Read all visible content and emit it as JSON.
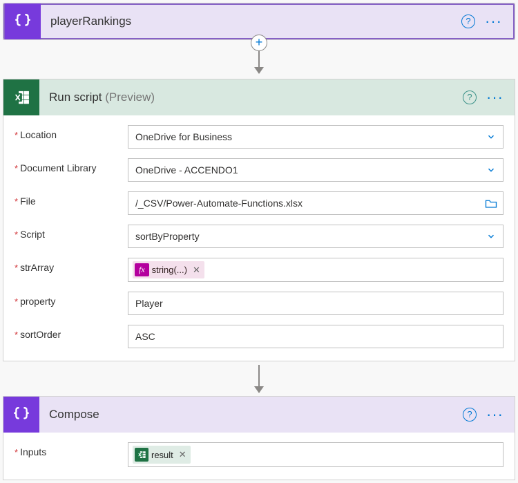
{
  "step1": {
    "title": "playerRankings"
  },
  "step2": {
    "title": "Run script",
    "previewSuffix": "(Preview)",
    "fields": {
      "location": {
        "label": "Location",
        "value": "OneDrive for Business"
      },
      "documentLibrary": {
        "label": "Document Library",
        "value": "OneDrive - ACCENDO1"
      },
      "file": {
        "label": "File",
        "value": "/_CSV/Power-Automate-Functions.xlsx"
      },
      "script": {
        "label": "Script",
        "value": "sortByProperty"
      },
      "strArray": {
        "label": "strArray",
        "chipBadge": "fx",
        "chipText": "string(...)"
      },
      "property": {
        "label": "property",
        "value": "Player"
      },
      "sortOrder": {
        "label": "sortOrder",
        "value": "ASC"
      }
    }
  },
  "step3": {
    "title": "Compose",
    "fields": {
      "inputs": {
        "label": "Inputs",
        "chipText": "result"
      }
    }
  }
}
